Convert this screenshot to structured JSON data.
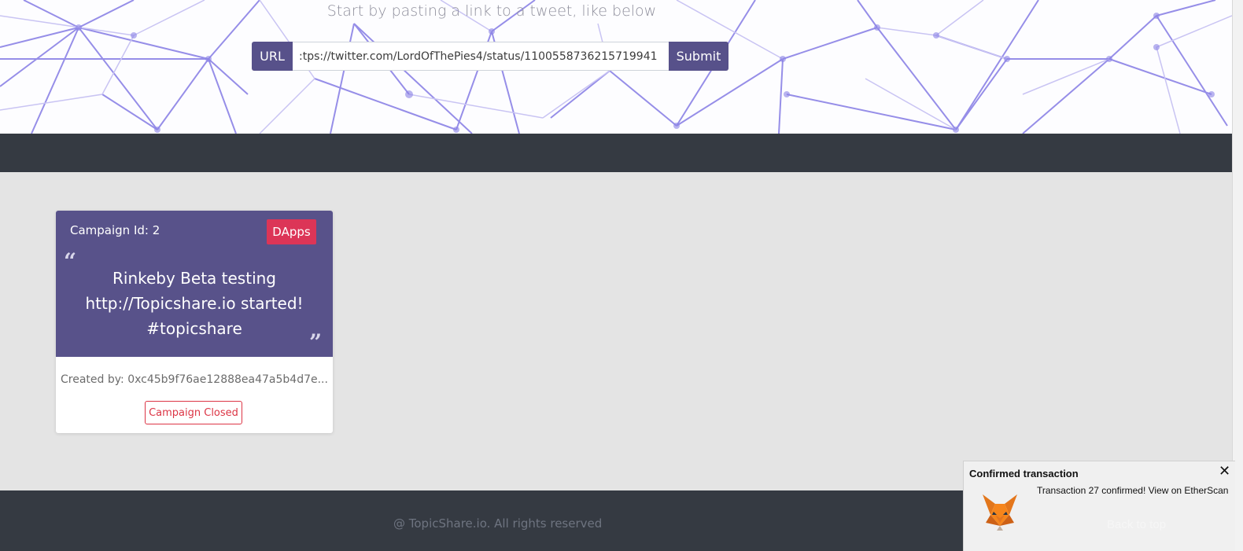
{
  "hero": {
    "subtitle": "Start by pasting a link to a tweet, like below",
    "url_prefix": "URL",
    "url_value": ":tps://twitter.com/LordOfThePies4/status/1100558736215719941",
    "submit_label": "Submit"
  },
  "card": {
    "campaign_id": "Campaign Id: 2",
    "badge": "DApps",
    "tweet_line1": "Rinkeby Beta testing",
    "tweet_line2": "http://Topicshare.io  started!",
    "tweet_line3": "#topicshare",
    "created_by": "Created by: 0xc45b9f76ae12888ea47a5b4d7e...",
    "status_button": "Campaign Closed",
    "quote_open": "“",
    "quote_close": "”"
  },
  "footer": {
    "copyright": "@ TopicShare.io. All rights reserved",
    "back_to_top": "Back to top"
  },
  "toast": {
    "title": "Confirmed transaction",
    "message": "Transaction 27 confirmed! View on EtherScan",
    "close": "✕",
    "icon": "metamask-fox-icon"
  },
  "colors": {
    "accent": "#57518a",
    "badge": "#dc3557",
    "dark": "#353a42",
    "danger": "#dc3545"
  }
}
